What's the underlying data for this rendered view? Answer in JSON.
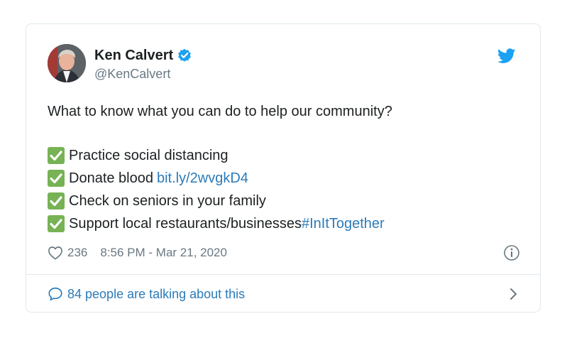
{
  "tweet": {
    "author": {
      "display_name": "Ken Calvert",
      "handle": "@KenCalvert"
    },
    "text": {
      "intro": "What to know what you can do to help our community?",
      "items": [
        {
          "text": "Practice social distancing"
        },
        {
          "text": "Donate blood",
          "link": "bit.ly/2wvgkD4"
        },
        {
          "text": "Check on seniors in your family"
        },
        {
          "text": "Support local restaurants/businesses",
          "hashtag": "#InItTogether"
        }
      ]
    },
    "likes": "236",
    "timestamp": "8:56 PM - Mar 21, 2020",
    "footer": "84 people are talking about this"
  },
  "icons": {
    "verified": "verified-badge-icon",
    "bird": "twitter-bird-icon",
    "check": "check-mark-button-emoji",
    "heart": "heart-outline-icon",
    "info": "info-circle-icon",
    "bubble": "speech-bubble-icon",
    "chevron": "chevron-right-icon"
  },
  "colors": {
    "link": "#2b7bb9",
    "secondary_text": "#697882",
    "check_green": "#77b255",
    "twitter_blue": "#1da1f2"
  }
}
